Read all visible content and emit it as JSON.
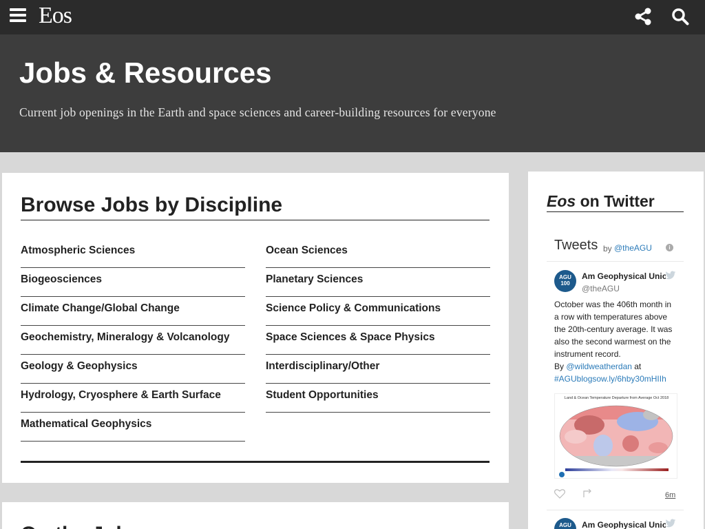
{
  "nav": {
    "logo": "Eos",
    "menu_icon": "hamburger-menu-icon",
    "share_icon": "share-icon",
    "search_icon": "search-icon"
  },
  "hero": {
    "title": "Jobs & Resources",
    "subtitle": "Current job openings in the Earth and space sciences and career-building resources for everyone"
  },
  "browse": {
    "title": "Browse Jobs by Discipline",
    "left_column": [
      "Atmospheric Sciences",
      "Biogeosciences",
      "Climate Change/Global Change",
      "Geochemistry, Mineralogy & Volcanology",
      "Geology & Geophysics",
      "Hydrology, Cryosphere & Earth Surface",
      "Mathematical Geophysics"
    ],
    "right_column": [
      "Ocean Sciences",
      "Planetary Sciences",
      "Science Policy & Communications",
      "Space Sciences & Space Physics",
      "Interdisciplinary/Other",
      "Student Opportunities"
    ]
  },
  "next_section": {
    "title": "On the Job"
  },
  "sidebar": {
    "title_em": "Eos",
    "title_rest": " on Twitter",
    "widget_head": "Tweets",
    "widget_by": "by",
    "widget_handle": "@theAGU",
    "info": "i",
    "avatar_text": "AGU 100",
    "tweets": [
      {
        "name": "Am Geophysical Union",
        "handle": "@theAGU",
        "text_main": "October was the 406th month in a row with temperatures above the 20th-century average. It was also the second warmest on the instrument record.",
        "text_by": "By ",
        "mention": "@wildweatherdan",
        "text_at": "  at ",
        "link": "#AGUblogsow.ly/6hby30mHIIh",
        "image_title": "Land & Ocean Temperature Departure from Average Oct 2018",
        "time": "6m"
      },
      {
        "name": "Am Geophysical Union"
      }
    ]
  },
  "colors": {
    "navbar": "#2b2b2b",
    "hero": "#3d3d3d",
    "link_blue": "#2b7bb9",
    "page_bg": "#d8d8d8"
  }
}
